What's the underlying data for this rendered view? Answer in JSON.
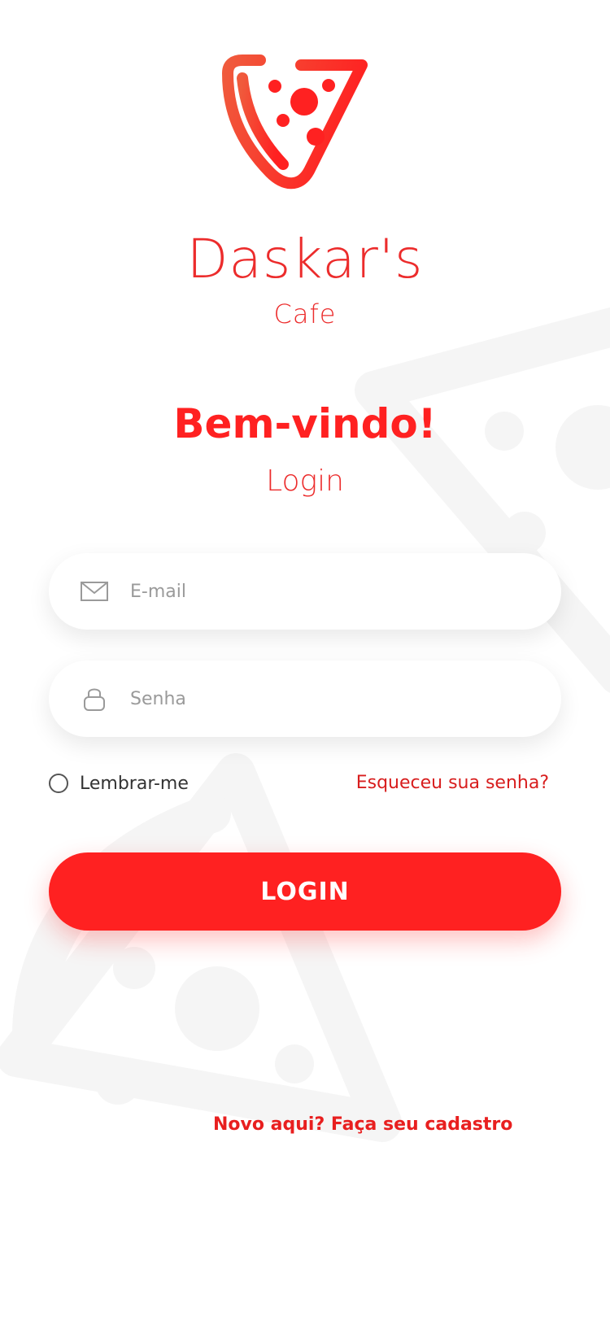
{
  "brand": {
    "name": "Daskar's",
    "subtitle": "Cafe"
  },
  "welcome": {
    "title": "Bem-vindo!",
    "subtitle": "Login"
  },
  "form": {
    "email_placeholder": "E-mail",
    "email_icon": "mail-icon",
    "password_placeholder": "Senha",
    "password_icon": "lock-icon",
    "remember_label": "Lembrar-me",
    "remember_checked": false,
    "forgot_label": "Esqueceu sua senha?",
    "login_label": "LOGIN"
  },
  "footer": {
    "signup_label": "Novo aqui? Faça seu cadastro"
  },
  "icons": {
    "logo": "pizza-slice-icon",
    "background": "pizza-slice-watermark"
  },
  "colors": {
    "primary": "#ff2121",
    "brand_text": "#ec2c2c",
    "logo_gradient_start": "#f05a3c",
    "logo_gradient_end": "#ff2121",
    "background": "#ffffff",
    "watermark": "#f6f6f6"
  }
}
